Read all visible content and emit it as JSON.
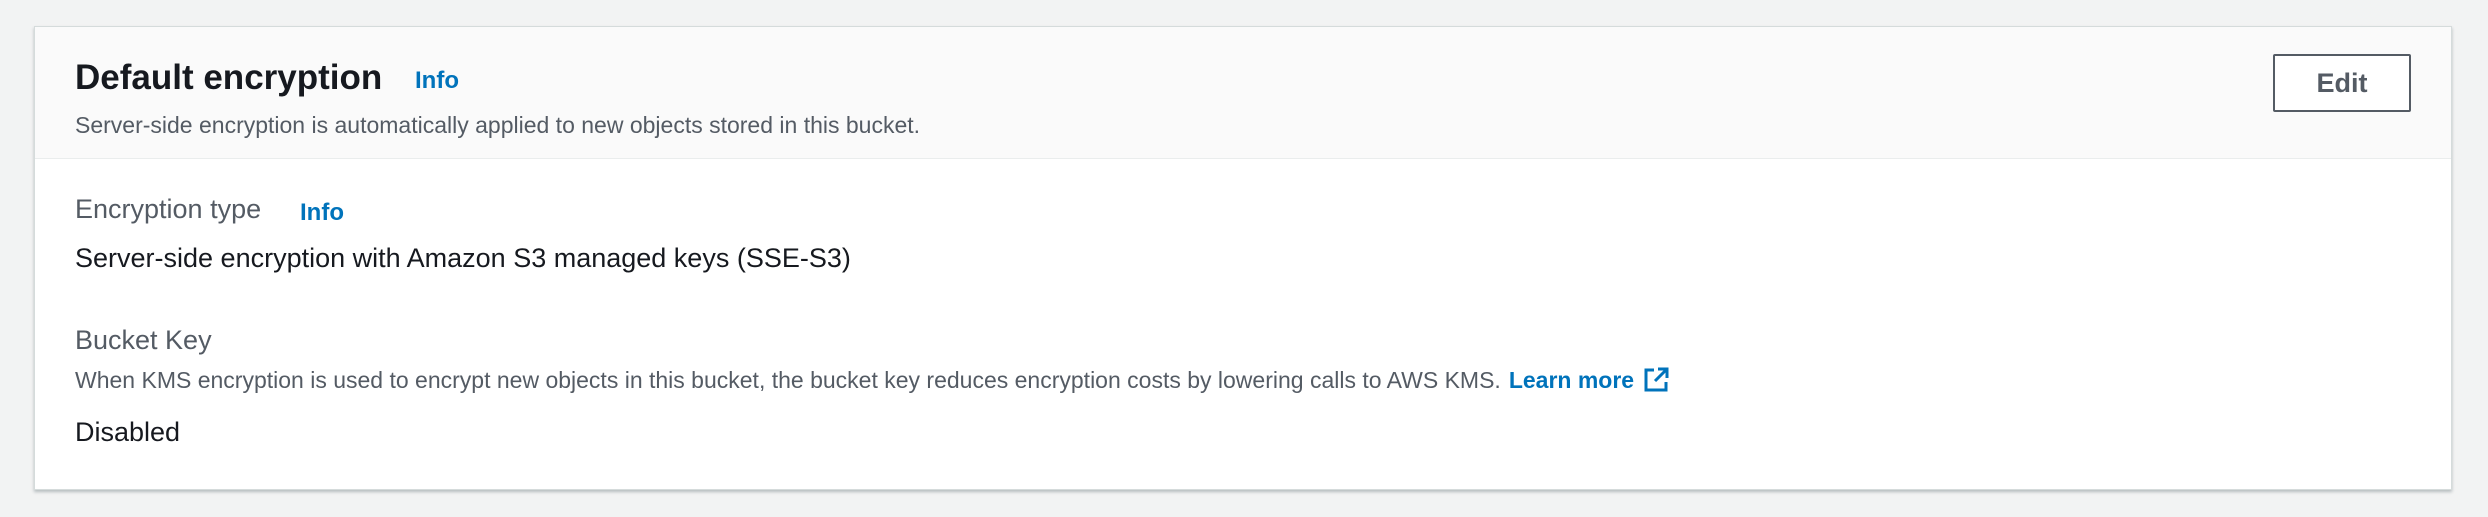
{
  "panel": {
    "title": "Default encryption",
    "title_info": "Info",
    "description": "Server-side encryption is automatically applied to new objects stored in this bucket.",
    "edit_label": "Edit"
  },
  "encryption_type": {
    "label": "Encryption type",
    "info": "Info",
    "value": "Server-side encryption with Amazon S3 managed keys (SSE-S3)"
  },
  "bucket_key": {
    "label": "Bucket Key",
    "description": "When KMS encryption is used to encrypt new objects in this bucket, the bucket key reduces encryption costs by lowering calls to AWS KMS.",
    "learn_more": "Learn more",
    "learn_more_icon": "external-link-icon",
    "value": "Disabled"
  },
  "colors": {
    "link": "#0073bb",
    "text": "#16191f",
    "secondary_text": "#545b64",
    "background": "#f2f3f3",
    "header_background": "#fafafa"
  }
}
